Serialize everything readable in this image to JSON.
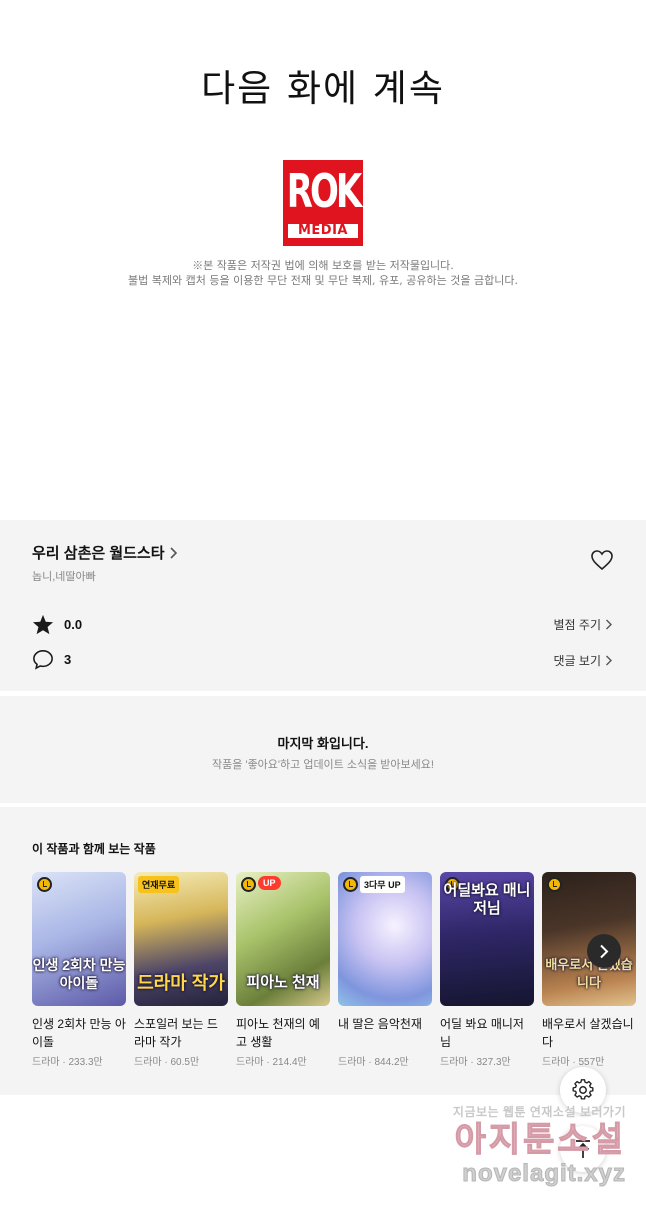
{
  "end_title": "다음 화에 계속",
  "logo": {
    "main": "ROK",
    "sub": "MEDIA",
    "color": "#e0141e"
  },
  "copyright": {
    "line1": "※본 작품은 저작권 법에 의해 보호를 받는 저작물입니다.",
    "line2": "불법 복제와 캡처 등을 이용한 무단 전재 및 무단 복제, 유포, 공유하는 것을 금합니다."
  },
  "info": {
    "title": "우리 삼촌은 월드스타",
    "authors": "놉니,네딸아빠",
    "rating": "0.0",
    "rate_link": "별점 주기",
    "comments": "3",
    "comments_link": "댓글 보기"
  },
  "last_episode": {
    "title": "마지막 화입니다.",
    "subtitle": "작품을 '좋아요'하고 업데이트 소식을 받아보세요!"
  },
  "recommendations": {
    "heading": "이 작품과 함께 보는 작품",
    "items": [
      {
        "title": "인생 2회차 만능 아이돌",
        "meta": "드라마 · 233.3만",
        "thumb_text": "인생 2회차 만능아이돌",
        "badge": "",
        "colors": [
          "#cfd9f2",
          "#6f6fb8"
        ]
      },
      {
        "title": "스포일러 보는 드라마 작가",
        "meta": "드라마 · 60.5만",
        "thumb_text": "드라마 작가",
        "badge": "연재무료",
        "colors": [
          "#f2e7a8",
          "#3a3550"
        ]
      },
      {
        "title": "피아노 천재의 예고 생활",
        "meta": "드라마 · 214.4만",
        "thumb_text": "피아노 천재",
        "badge": "UP",
        "colors": [
          "#c9dba0",
          "#6f8a40"
        ]
      },
      {
        "title": "내 딸은 음악천재",
        "meta": "드라마 · 844.2만",
        "thumb_text": "",
        "badge": "3다무 UP",
        "colors": [
          "#d8d4f5",
          "#7c93d8"
        ]
      },
      {
        "title": "어딜 봐요 매니저님",
        "meta": "드라마 · 327.3만",
        "thumb_text": "어딜봐요 매니저님",
        "badge": "",
        "colors": [
          "#4a3c8c",
          "#161635"
        ]
      },
      {
        "title": "배우로서 살겠습니다",
        "meta": "드라마 · 557만",
        "thumb_text": "배우로서 살겠습니다",
        "badge": "",
        "colors": [
          "#3a2a22",
          "#c08a55"
        ]
      }
    ]
  },
  "watermark": {
    "line1": "지금보는 웹툰 연재소설 보러가기",
    "line2": "아지툰소설",
    "line3": "novelagit.xyz"
  }
}
